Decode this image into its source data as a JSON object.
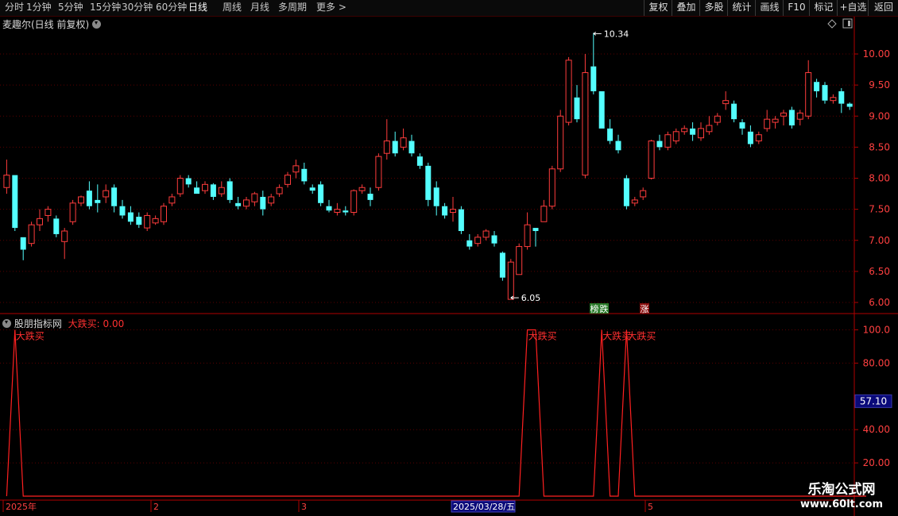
{
  "toolbar": {
    "periods": [
      {
        "label": "分时",
        "active": false
      },
      {
        "label": "1分钟",
        "active": false
      },
      {
        "label": "5分钟",
        "active": false
      },
      {
        "label": "15分钟",
        "active": false
      },
      {
        "label": "30分钟",
        "active": false
      },
      {
        "label": "60分钟",
        "active": false
      },
      {
        "label": "日线",
        "active": true
      },
      {
        "label": "周线",
        "active": false
      },
      {
        "label": "月线",
        "active": false
      },
      {
        "label": "多周期",
        "active": false
      },
      {
        "label": "更多 >",
        "active": false
      }
    ],
    "actions": [
      "复权",
      "叠加",
      "多股",
      "统计",
      "画线",
      "F10",
      "标记",
      "+自选",
      "返回"
    ]
  },
  "main_panel": {
    "title": "麦趣尔(日线 前复权)",
    "high_label": "10.34",
    "low_label": "6.05",
    "tags": [
      {
        "text": "榜",
        "color": "#2a7a2a"
      },
      {
        "text": "跌",
        "color": "#2a7a2a"
      },
      {
        "text": "涨",
        "color": "#8a1010"
      }
    ],
    "y_ticks": [
      "10.00",
      "9.50",
      "9.00",
      "8.50",
      "8.00",
      "7.50",
      "7.00",
      "6.50",
      "6.00"
    ]
  },
  "indicator_panel": {
    "title": "股朋指标网",
    "value_label": "大跌买: 0.00",
    "signal_label": "大跌买",
    "y_ticks": [
      "100.0",
      "80.00",
      "57.10",
      "40.00",
      "20.00"
    ],
    "current_value": "57.10"
  },
  "x_axis": {
    "labels": [
      "2025年",
      "2",
      "3",
      "2025/03/28/五",
      "5"
    ]
  },
  "watermark": {
    "line1": "乐淘公式网",
    "line2": "www.60lt.com"
  },
  "colors": {
    "up": "#ff3c3c",
    "down": "#54ffff",
    "grid": "#5a0000",
    "axis": "#b00000",
    "indicator_line": "#ff2020"
  },
  "chart_data": [
    {
      "type": "candlestick",
      "title": "麦趣尔(日线 前复权)",
      "y_range": [
        5.9,
        10.5
      ],
      "candles": [
        [
          7.85,
          8.05,
          8.3,
          7.75
        ],
        [
          8.05,
          7.2,
          8.05,
          7.15
        ],
        [
          7.05,
          6.85,
          7.05,
          6.68
        ],
        [
          6.95,
          7.25,
          7.3,
          6.9
        ],
        [
          7.25,
          7.35,
          7.5,
          7.15
        ],
        [
          7.4,
          7.5,
          7.55,
          7.3
        ],
        [
          7.35,
          7.1,
          7.4,
          7.05
        ],
        [
          6.98,
          7.15,
          7.2,
          6.7
        ],
        [
          7.3,
          7.6,
          7.65,
          7.25
        ],
        [
          7.6,
          7.7,
          7.72,
          7.55
        ],
        [
          7.8,
          7.55,
          7.95,
          7.5
        ],
        [
          7.65,
          7.6,
          7.9,
          7.45
        ],
        [
          7.7,
          7.8,
          7.9,
          7.6
        ],
        [
          7.85,
          7.55,
          7.9,
          7.45
        ],
        [
          7.55,
          7.4,
          7.65,
          7.35
        ],
        [
          7.45,
          7.3,
          7.55,
          7.25
        ],
        [
          7.38,
          7.25,
          7.45,
          7.2
        ],
        [
          7.2,
          7.4,
          7.45,
          7.15
        ],
        [
          7.28,
          7.35,
          7.4,
          7.25
        ],
        [
          7.3,
          7.55,
          7.6,
          7.25
        ],
        [
          7.6,
          7.7,
          7.75,
          7.55
        ],
        [
          7.75,
          8.0,
          8.05,
          7.7
        ],
        [
          8.0,
          7.9,
          8.05,
          7.85
        ],
        [
          7.85,
          7.75,
          7.95,
          7.75
        ],
        [
          7.8,
          7.9,
          7.95,
          7.75
        ],
        [
          7.9,
          7.7,
          7.92,
          7.65
        ],
        [
          7.75,
          7.85,
          7.95,
          7.7
        ],
        [
          7.95,
          7.65,
          8.0,
          7.6
        ],
        [
          7.6,
          7.55,
          7.7,
          7.5
        ],
        [
          7.55,
          7.65,
          7.7,
          7.5
        ],
        [
          7.62,
          7.75,
          7.78,
          7.55
        ],
        [
          7.7,
          7.5,
          7.8,
          7.4
        ],
        [
          7.6,
          7.7,
          7.75,
          7.55
        ],
        [
          7.75,
          7.85,
          7.9,
          7.7
        ],
        [
          7.9,
          8.05,
          8.1,
          7.85
        ],
        [
          8.1,
          8.2,
          8.3,
          8.0
        ],
        [
          8.15,
          7.95,
          8.25,
          7.9
        ],
        [
          7.85,
          7.8,
          7.9,
          7.75
        ],
        [
          7.9,
          7.6,
          7.95,
          7.55
        ],
        [
          7.55,
          7.48,
          7.65,
          7.45
        ],
        [
          7.45,
          7.5,
          7.6,
          7.4
        ],
        [
          7.48,
          7.45,
          7.55,
          7.4
        ],
        [
          7.45,
          7.8,
          7.82,
          7.4
        ],
        [
          7.8,
          7.85,
          7.9,
          7.75
        ],
        [
          7.75,
          7.65,
          7.85,
          7.55
        ],
        [
          7.85,
          8.35,
          8.4,
          7.8
        ],
        [
          8.4,
          8.6,
          8.95,
          8.3
        ],
        [
          8.6,
          8.4,
          8.75,
          8.35
        ],
        [
          8.5,
          8.65,
          8.8,
          8.45
        ],
        [
          8.6,
          8.4,
          8.7,
          8.35
        ],
        [
          8.35,
          8.2,
          8.4,
          8.15
        ],
        [
          8.2,
          7.65,
          8.25,
          7.55
        ],
        [
          7.85,
          7.55,
          7.95,
          7.4
        ],
        [
          7.55,
          7.4,
          7.6,
          7.35
        ],
        [
          7.45,
          7.5,
          7.7,
          7.3
        ],
        [
          7.5,
          7.15,
          7.55,
          7.1
        ],
        [
          7.0,
          6.9,
          7.1,
          6.85
        ],
        [
          6.95,
          7.05,
          7.1,
          6.9
        ],
        [
          7.05,
          7.15,
          7.18,
          7.0
        ],
        [
          7.08,
          6.95,
          7.15,
          6.9
        ],
        [
          6.8,
          6.4,
          6.82,
          6.35
        ],
        [
          6.05,
          6.65,
          6.7,
          6.05
        ],
        [
          6.45,
          6.9,
          6.95,
          6.45
        ],
        [
          6.9,
          7.25,
          7.45,
          6.85
        ],
        [
          7.2,
          7.15,
          7.2,
          6.9
        ],
        [
          7.3,
          7.55,
          7.65,
          7.3
        ],
        [
          7.55,
          8.15,
          8.2,
          7.5
        ],
        [
          8.15,
          9.0,
          9.1,
          8.1
        ],
        [
          8.9,
          9.9,
          9.95,
          8.85
        ],
        [
          9.3,
          8.95,
          9.5,
          8.9
        ],
        [
          8.05,
          9.7,
          10.0,
          8.0
        ],
        [
          9.8,
          9.4,
          10.34,
          9.35
        ],
        [
          9.4,
          8.8,
          9.4,
          8.8
        ],
        [
          8.8,
          8.6,
          8.95,
          8.55
        ],
        [
          8.6,
          8.45,
          8.7,
          8.4
        ],
        [
          8.0,
          7.55,
          8.05,
          7.5
        ],
        [
          7.6,
          7.65,
          7.7,
          7.55
        ],
        [
          7.7,
          7.8,
          7.85,
          7.65
        ],
        [
          8.0,
          8.6,
          8.62,
          7.98
        ],
        [
          8.6,
          8.5,
          8.7,
          8.45
        ],
        [
          8.5,
          8.7,
          8.75,
          8.45
        ],
        [
          8.6,
          8.75,
          8.8,
          8.55
        ],
        [
          8.75,
          8.8,
          8.85,
          8.7
        ],
        [
          8.8,
          8.7,
          8.9,
          8.6
        ],
        [
          8.65,
          8.8,
          8.9,
          8.6
        ],
        [
          8.75,
          8.85,
          9.0,
          8.7
        ],
        [
          8.9,
          9.0,
          9.05,
          8.85
        ],
        [
          9.2,
          9.25,
          9.4,
          9.1
        ],
        [
          9.2,
          8.95,
          9.25,
          8.9
        ],
        [
          8.9,
          8.8,
          8.95,
          8.7
        ],
        [
          8.75,
          8.55,
          8.85,
          8.5
        ],
        [
          8.6,
          8.7,
          8.75,
          8.55
        ],
        [
          8.8,
          8.95,
          9.1,
          8.75
        ],
        [
          8.9,
          8.95,
          9.0,
          8.8
        ],
        [
          9.0,
          9.05,
          9.1,
          8.85
        ],
        [
          9.1,
          8.85,
          9.15,
          8.8
        ],
        [
          8.95,
          9.05,
          9.1,
          8.85
        ],
        [
          9.0,
          9.7,
          9.9,
          8.95
        ],
        [
          9.55,
          9.4,
          9.6,
          9.3
        ],
        [
          9.5,
          9.25,
          9.55,
          9.2
        ],
        [
          9.25,
          9.3,
          9.35,
          9.2
        ],
        [
          9.4,
          9.2,
          9.45,
          9.05
        ],
        [
          9.2,
          9.15,
          9.22,
          9.1
        ]
      ]
    },
    {
      "type": "line",
      "title": "股朋指标网",
      "series": [
        {
          "name": "大跌买",
          "points": [
            [
              0,
              0
            ],
            [
              1,
              100
            ],
            [
              2,
              0
            ],
            [
              62,
              0
            ],
            [
              63,
              100
            ],
            [
              64,
              100
            ],
            [
              65,
              0
            ],
            [
              71,
              0
            ],
            [
              72,
              100
            ],
            [
              73,
              0
            ],
            [
              74,
              0
            ],
            [
              75,
              100
            ],
            [
              76,
              0
            ],
            [
              104,
              0
            ]
          ]
        }
      ],
      "ylim": [
        0,
        100
      ]
    }
  ]
}
